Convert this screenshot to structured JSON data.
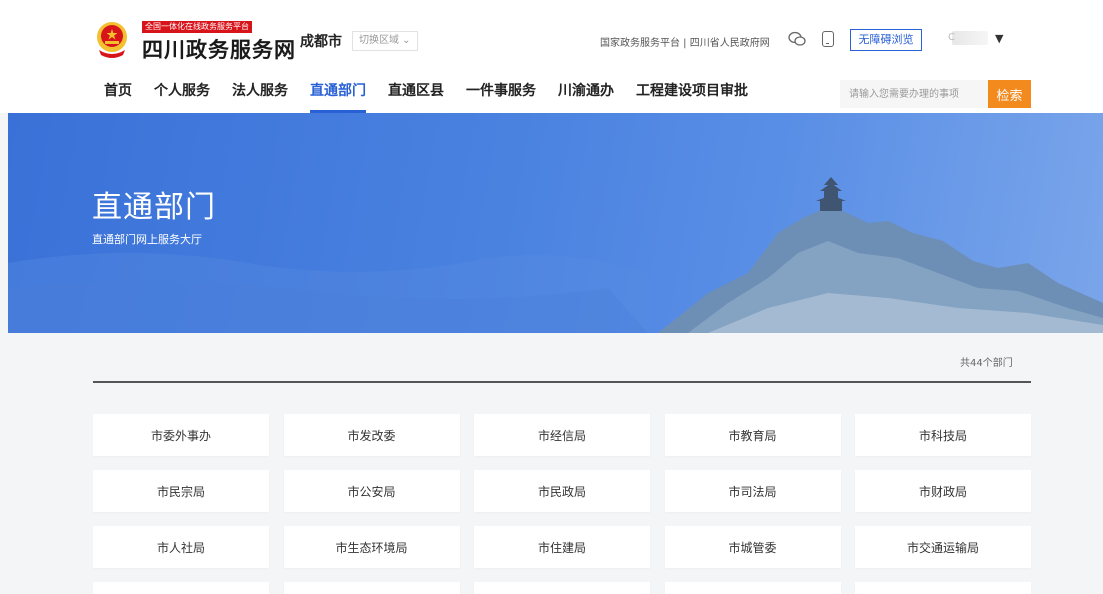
{
  "header": {
    "badge": "全国一体化在线政务服务平台",
    "site_name": "四川政务服务网",
    "city": "成都市",
    "switch_region": "切换区域 ⌄",
    "links": "国家政务服务平台 | 四川省人民政府网",
    "accessible_label": "无障碍浏览",
    "user_initial": "C",
    "caret": "▼"
  },
  "nav": {
    "items": [
      "首页",
      "个人服务",
      "法人服务",
      "直通部门",
      "直通区县",
      "一件事服务",
      "川渝通办",
      "工程建设项目审批"
    ],
    "active_index": 3
  },
  "search": {
    "placeholder": "请输入您需要办理的事项",
    "value": "",
    "button": "检索"
  },
  "banner": {
    "title": "直通部门",
    "subtitle": "直通部门网上服务大厅"
  },
  "departments": {
    "count_label": "共44个部门",
    "items": [
      "市委外事办",
      "市发改委",
      "市经信局",
      "市教育局",
      "市科技局",
      "市民宗局",
      "市公安局",
      "市民政局",
      "市司法局",
      "市财政局",
      "市人社局",
      "市生态环境局",
      "市住建局",
      "市城管委",
      "市交通运输局"
    ]
  },
  "colors": {
    "accent": "#2860d6",
    "search_button": "#f28a1e",
    "badge": "#d8141b",
    "banner": "#4a82e0"
  },
  "icons": [
    "national-emblem-icon",
    "wechat-icon",
    "mobile-icon",
    "chevron-down-icon"
  ]
}
